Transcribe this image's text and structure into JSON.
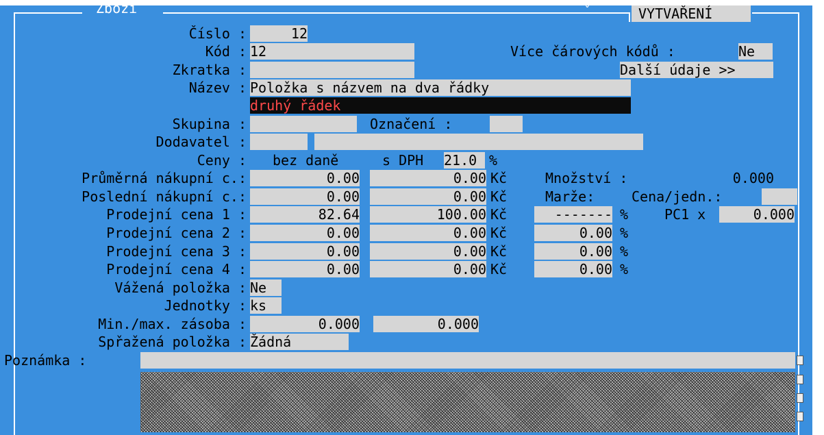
{
  "window": {
    "title": "Zboží",
    "mode": "VYTVAŘENÍ"
  },
  "fields": {
    "cislo": {
      "label": "Číslo :",
      "value": "12"
    },
    "kod": {
      "label": "Kód :",
      "value": "12"
    },
    "zkratka": {
      "label": "Zkratka :",
      "value": ""
    },
    "nazev": {
      "label": "Název :",
      "line1": "Položka s názvem na dva řádky",
      "line2": "druhý řádek"
    },
    "skupina": {
      "label": "Skupina :",
      "value": ""
    },
    "oznaceni": {
      "label": "Označení :",
      "value": ""
    },
    "dodavatel": {
      "label": "Dodavatel :"
    },
    "vice_carovych": {
      "label": "Více čárových kódů :",
      "value": "Ne"
    },
    "dalsi_udaje": "Další údaje >>"
  },
  "prices": {
    "label": "Ceny :",
    "col_net": "bez daně",
    "col_gross": "s DPH",
    "vat": "21.0",
    "pct": "%",
    "currency": "Kč",
    "rows": [
      {
        "label": "Průměrná nákupní c.:",
        "net": "0.00",
        "gross": "0.00"
      },
      {
        "label": "Poslední nákupní c.:",
        "net": "0.00",
        "gross": "0.00"
      },
      {
        "label": "Prodejní cena 1 :",
        "net": "82.64",
        "gross": "100.00",
        "margin": "-------"
      },
      {
        "label": "Prodejní cena 2 :",
        "net": "0.00",
        "gross": "0.00",
        "margin": "0.00"
      },
      {
        "label": "Prodejní cena 3 :",
        "net": "0.00",
        "gross": "0.00",
        "margin": "0.00"
      },
      {
        "label": "Prodejní cena 4 :",
        "net": "0.00",
        "gross": "0.00",
        "margin": "0.00"
      }
    ],
    "mnozstvi_label": "Množství :",
    "mnozstvi_value": "0.000",
    "marze_label": "Marže:",
    "cena_jedn_label": "Cena/jedn.:",
    "pc1_label": "PC1 x",
    "pc1_value": "0.000"
  },
  "lower": {
    "vazena": {
      "label": "Vážená položka :",
      "value": "Ne"
    },
    "jednotky": {
      "label": "Jednotky :",
      "value": "ks"
    },
    "zasoba": {
      "label": "Min./max. zásoba :",
      "min": "0.000",
      "max": "0.000"
    },
    "sprazena": {
      "label": "Spřažená položka :",
      "value": "Žádná"
    },
    "poznamka": {
      "label": "Poznámka :"
    }
  }
}
